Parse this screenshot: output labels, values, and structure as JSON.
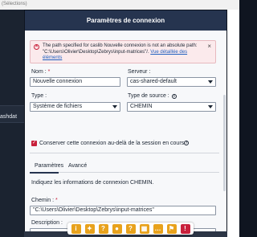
{
  "background": {
    "top_text": "(Sélections)",
    "left_item": "ashdat"
  },
  "dialog": {
    "title": "Paramètres de connexion",
    "error": {
      "message": "The path specified for caslib Nouvelle connexion is not an absolute path: \"C:\\Users\\Olivier\\Desktop\\Zebrys\\input-matrices\"/.",
      "link": "Vue détaillée des éléments"
    },
    "name_label": "Nom :",
    "name_value": "Nouvelle connexion",
    "server_label": "Serveur :",
    "server_value": "cas-shared-default",
    "type_label": "Type :",
    "type_value": "Système de fichiers",
    "source_type_label": "Type de source :",
    "source_type_value": "CHEMIN",
    "keep_label": "Conserver cette connexion au-delà de la session en cours.",
    "tabs": [
      "Paramètres",
      "Avancé"
    ],
    "instructions": "Indiquez les informations de connexion CHEMIN.",
    "path_label": "Chemin :",
    "path_value": "\"C:\\Users\\Olivier\\Desktop\\Zebrys\\input-matrices\"",
    "description_label": "Description :",
    "description_value": ""
  },
  "toolbar": {
    "icons": [
      {
        "name": "info-icon",
        "glyph": "i",
        "color": "#e8a21c"
      },
      {
        "name": "bulb-icon",
        "glyph": "✦",
        "color": "#e8a21c"
      },
      {
        "name": "help-icon",
        "glyph": "?",
        "color": "#e8a21c"
      },
      {
        "name": "user-icon",
        "glyph": "●",
        "color": "#e8a21c"
      },
      {
        "name": "question-icon",
        "glyph": "?",
        "color": "#e8a21c"
      },
      {
        "name": "calendar-icon",
        "glyph": "▦",
        "color": "#e8a21c"
      },
      {
        "name": "chat-icon",
        "glyph": "…",
        "color": "#e8a21c"
      },
      {
        "name": "flag-icon",
        "glyph": "⚑",
        "color": "#e8a21c"
      },
      {
        "name": "alert-icon",
        "glyph": "!",
        "color": "#c8203b"
      }
    ]
  },
  "colors": {
    "header": "#26344f",
    "accent": "#c8203b",
    "link": "#1f5fbf"
  }
}
